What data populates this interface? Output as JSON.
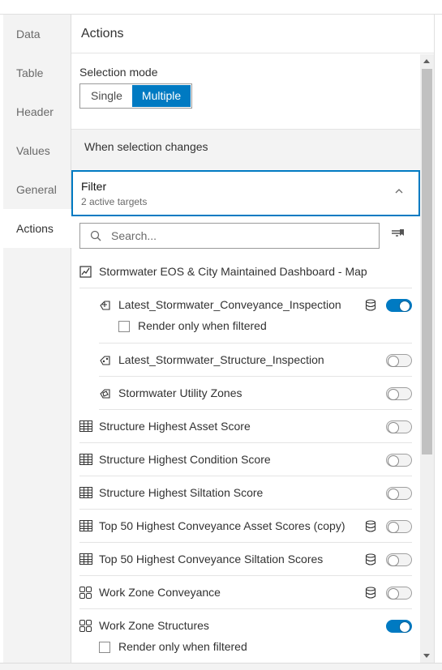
{
  "tabs": [
    {
      "label": "Data"
    },
    {
      "label": "Table"
    },
    {
      "label": "Header"
    },
    {
      "label": "Values"
    },
    {
      "label": "General"
    },
    {
      "label": "Actions"
    }
  ],
  "panel": {
    "title": "Actions",
    "selection_mode": {
      "label": "Selection mode",
      "options": [
        "Single",
        "Multiple"
      ],
      "selected": "Multiple"
    },
    "when_selection_changes": "When selection changes",
    "filter": {
      "title": "Filter",
      "subtitle": "2 active targets"
    },
    "search": {
      "placeholder": "Search..."
    },
    "map": {
      "label": "Stormwater EOS & City Maintained Dashboard - Map",
      "icon": "map-icon"
    },
    "layers": [
      {
        "label": "Latest_Stormwater_Conveyance_Inspection",
        "icon": "line-layer-icon",
        "database": true,
        "enabled": true,
        "render_only_when_filtered": "Render only when filtered"
      },
      {
        "label": "Latest_Stormwater_Structure_Inspection",
        "icon": "point-layer-icon",
        "database": false,
        "enabled": false
      },
      {
        "label": "Stormwater Utility Zones",
        "icon": "polygon-layer-icon",
        "database": false,
        "enabled": false
      }
    ],
    "widgets": [
      {
        "label": "Structure Highest Asset Score",
        "icon": "table-icon",
        "database": false,
        "enabled": false
      },
      {
        "label": "Structure Highest Condition Score",
        "icon": "table-icon",
        "database": false,
        "enabled": false
      },
      {
        "label": "Structure Highest Siltation Score",
        "icon": "table-icon",
        "database": false,
        "enabled": false
      },
      {
        "label": "Top 50 Highest Conveyance Asset Scores (copy)",
        "icon": "table-icon",
        "database": true,
        "enabled": false
      },
      {
        "label": "Top 50 Highest Conveyance Siltation Scores",
        "icon": "table-icon",
        "database": true,
        "enabled": false
      },
      {
        "label": "Work Zone Conveyance",
        "icon": "grid-icon",
        "database": true,
        "enabled": false
      },
      {
        "label": "Work Zone Structures",
        "icon": "grid-icon",
        "database": false,
        "enabled": true,
        "render_only_when_filtered": "Render only when filtered"
      }
    ]
  },
  "colors": {
    "accent": "#007ac2",
    "text": "#323232",
    "muted": "#6a6a6a"
  }
}
